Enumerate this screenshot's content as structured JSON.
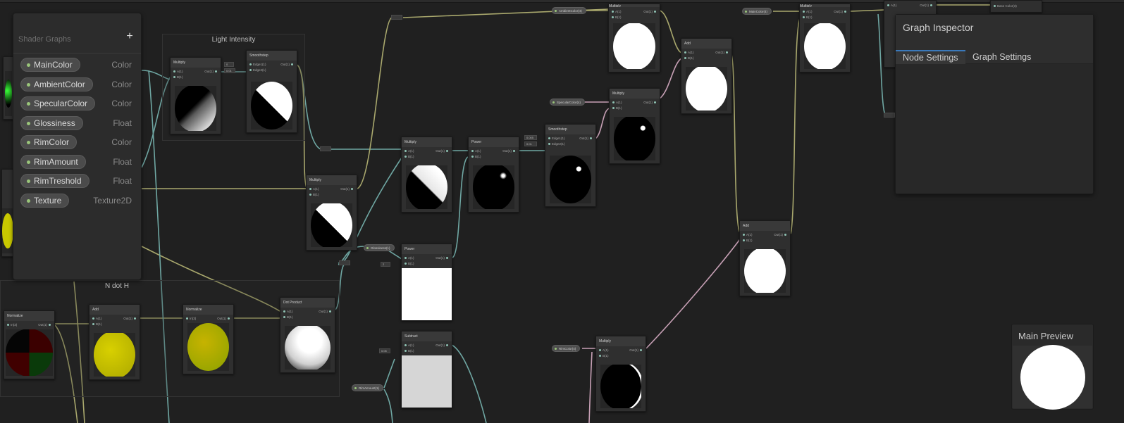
{
  "canvas": {
    "background": "#202020"
  },
  "blackboard": {
    "title": "Shader Graphs",
    "add_label": "+",
    "properties": [
      {
        "name": "MainColor",
        "type": "Color"
      },
      {
        "name": "AmbientColor",
        "type": "Color"
      },
      {
        "name": "SpecularColor",
        "type": "Color"
      },
      {
        "name": "Glossiness",
        "type": "Float"
      },
      {
        "name": "RimColor",
        "type": "Color"
      },
      {
        "name": "RimAmount",
        "type": "Float"
      },
      {
        "name": "RimTreshold",
        "type": "Float"
      },
      {
        "name": "Texture",
        "type": "Texture2D"
      }
    ]
  },
  "groups": {
    "light_intensity": "Light Intensity",
    "n_dot_h": "N dot H"
  },
  "nodes": {
    "multiply": "Multiply",
    "smoothstep": "Smoothstep",
    "add": "Add",
    "power": "Power",
    "normalize": "Normalize",
    "dot_product": "Dot Product",
    "subtract": "Subtract",
    "port_a": "A(1)",
    "port_b": "B(1)",
    "port_out": "Out(1)",
    "port_in": "In(3)",
    "port_edge1": "Edge1(1)",
    "port_edge2": "Edge2(1)"
  },
  "properties_on_canvas": {
    "ambient": "AmbientColor(4)",
    "specular": "SpecularColor(4)",
    "glossiness": "Glossiness(1)",
    "rim_amount": "RimAmount(1)",
    "rim_color": "RimColor(4)",
    "main_color": "MainColor(4)",
    "base_color": "Base Color(3)"
  },
  "inspector": {
    "title": "Graph Inspector",
    "tabs": [
      "Node Settings",
      "Graph Settings"
    ],
    "accent": "#3a79bb"
  },
  "main_preview": {
    "title": "Main Preview"
  }
}
